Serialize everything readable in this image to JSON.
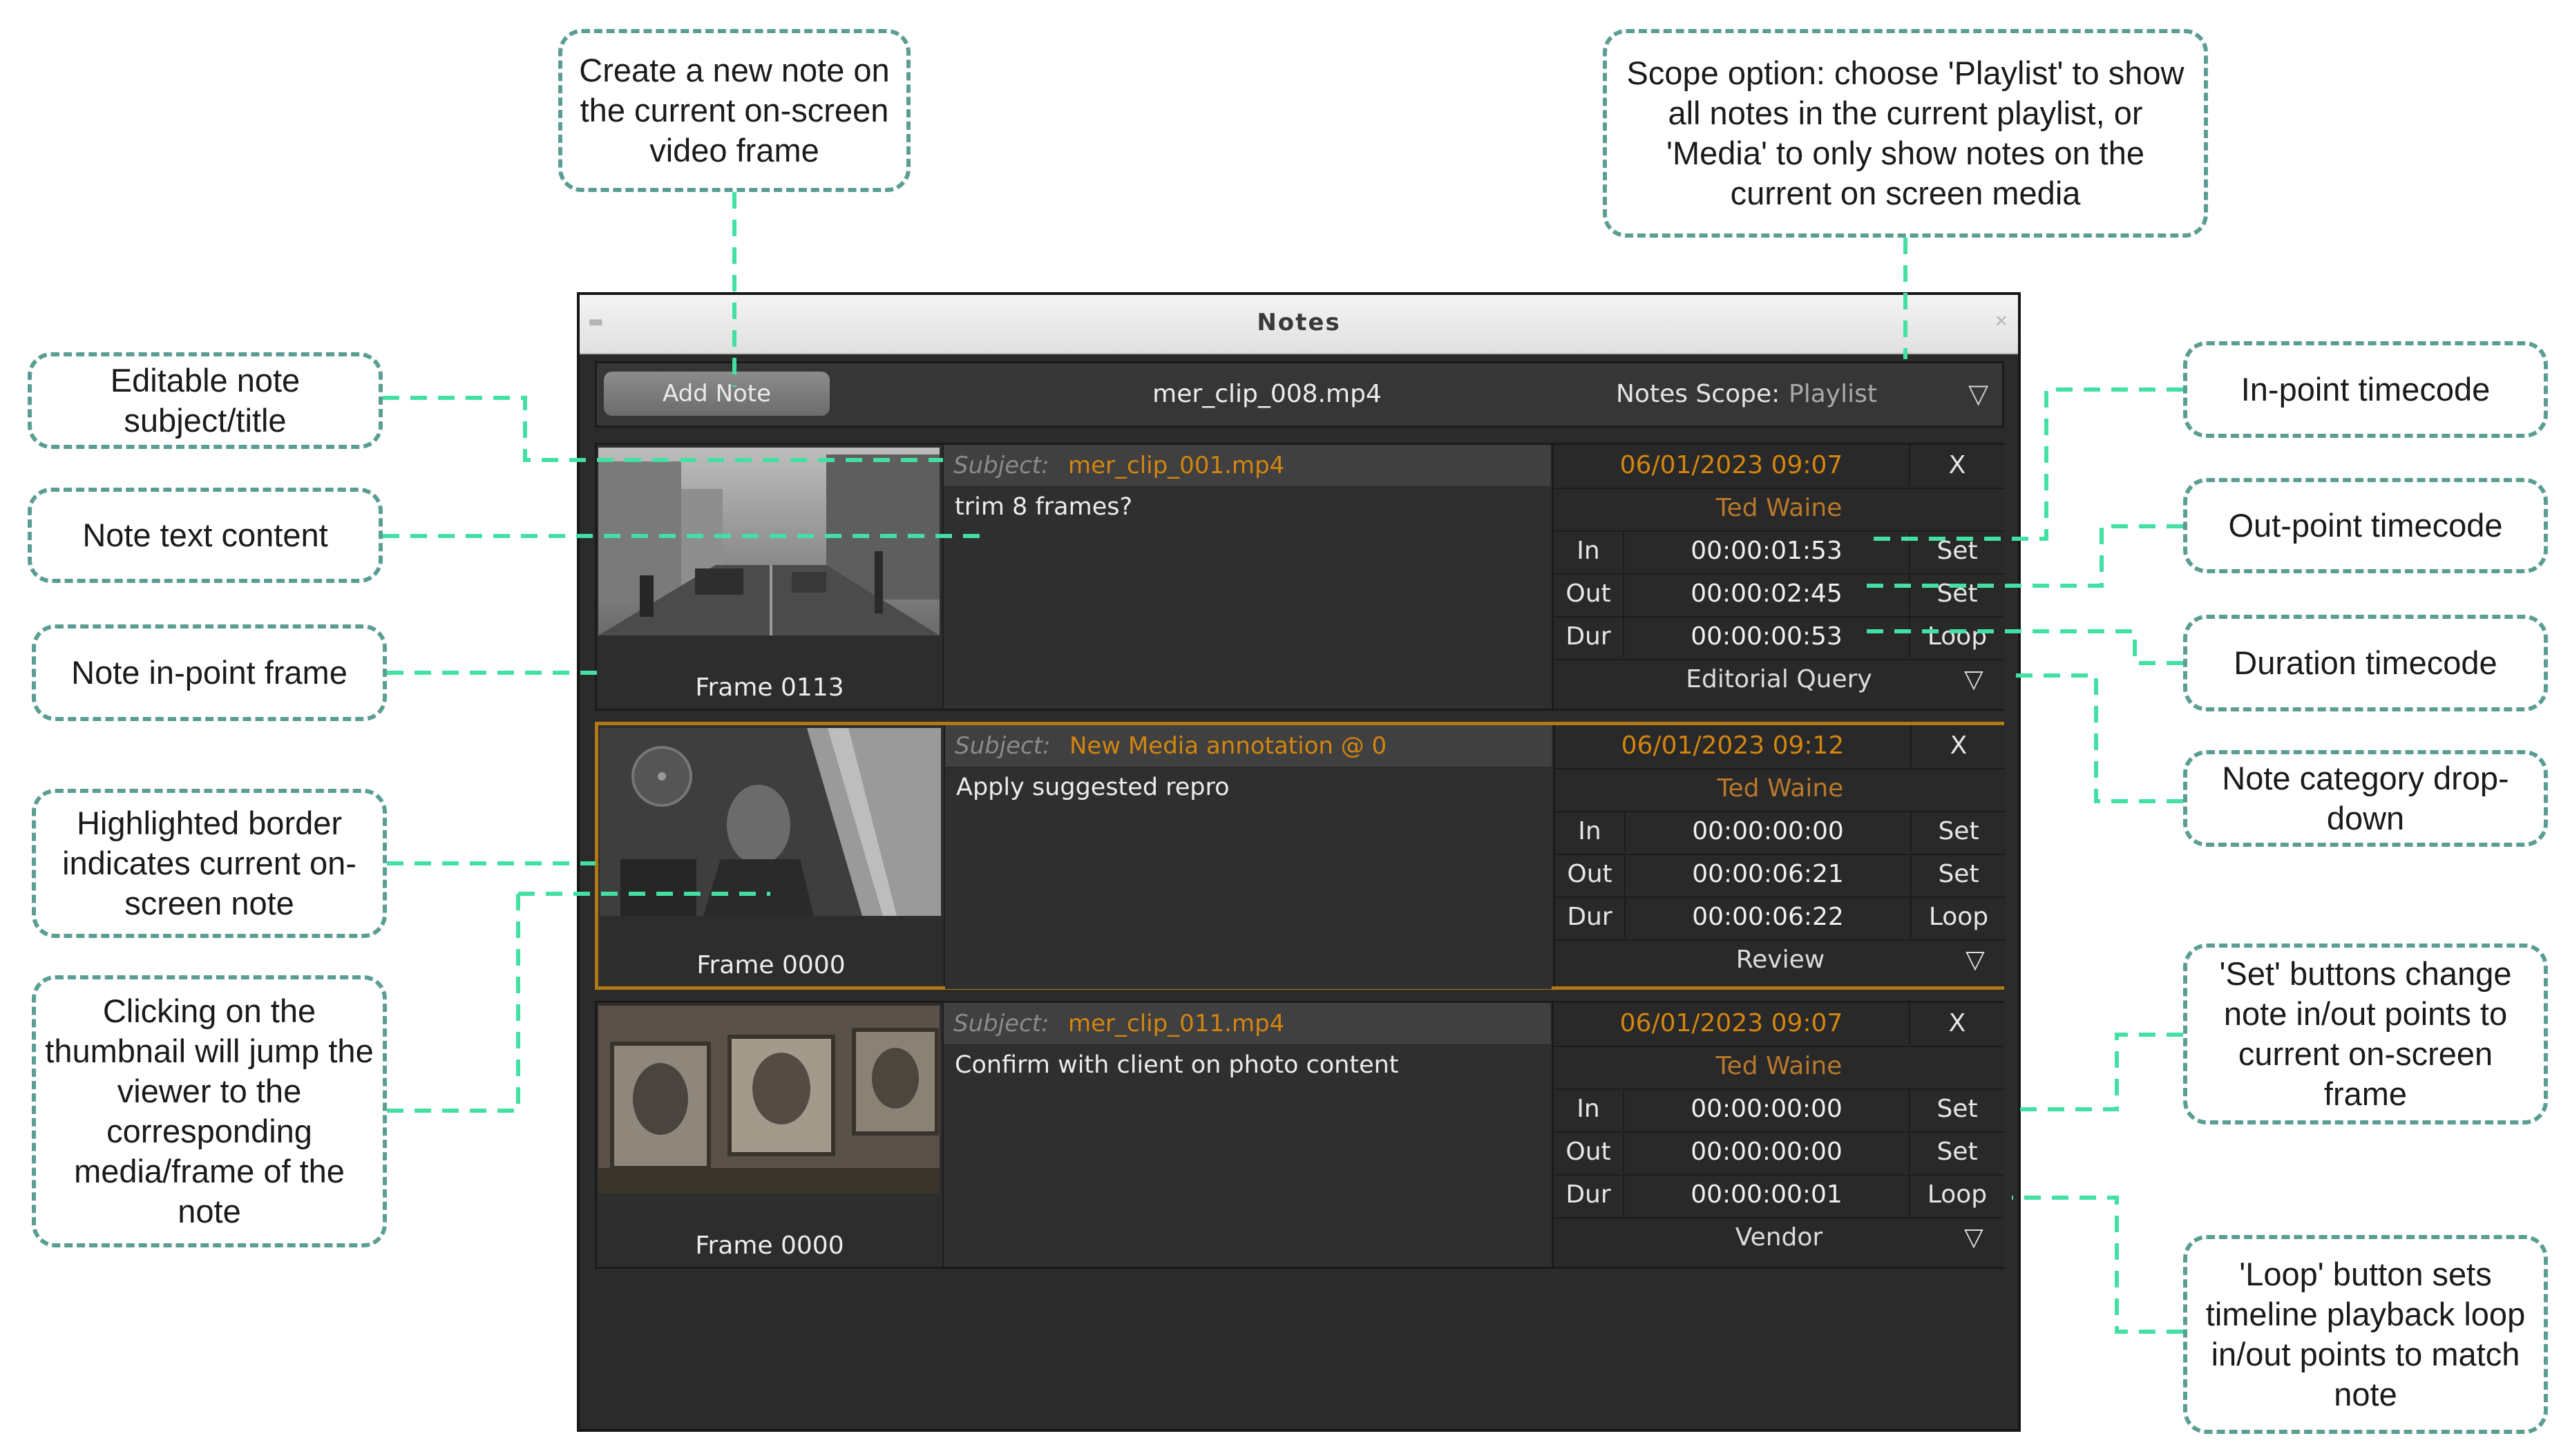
{
  "callouts": {
    "add_note": "Create a new note on\nthe current on-screen\nvideo frame",
    "scope": "Scope option: choose 'Playlist' to show\nall notes in the current playlist, or\n'Media' to only show notes on the\ncurrent on screen media",
    "subject": "Editable note\nsubject/title",
    "text_content": "Note text content",
    "in_frame": "Note in-point frame",
    "highlight": "Highlighted border\nindicates current on-\nscreen note",
    "thumbnail": "Clicking on the\nthumbnail will jump the\nviewer to the\ncorresponding\nmedia/frame of the\nnote",
    "in_tc": "In-point timecode",
    "out_tc": "Out-point timecode",
    "dur_tc": "Duration timecode",
    "category": "Note category drop-\ndown",
    "set_btn": "'Set' buttons change\nnote in/out points to\ncurrent on-screen frame",
    "loop_btn": "'Loop' button sets\ntimeline playback loop\nin/out points to match\nnote"
  },
  "window": {
    "title": "Notes",
    "add_note_label": "Add Note",
    "media_name": "mer_clip_008.mp4",
    "scope_label": "Notes Scope:",
    "scope_value": "Playlist",
    "dropdown_glyph": "▽",
    "close_glyph": "X"
  },
  "notes": [
    {
      "frame_label": "Frame 0113",
      "subject_prefix": "Subject:",
      "subject": "mer_clip_001.mp4",
      "text": "trim 8 frames?",
      "date": "06/01/2023 09:07",
      "author": "Ted Waine",
      "in_label": "In",
      "in_tc": "00:00:01:53",
      "out_label": "Out",
      "out_tc": "00:00:02:45",
      "dur_label": "Dur",
      "dur_tc": "00:00:00:53",
      "set_label": "Set",
      "loop_label": "Loop",
      "category": "Editorial Query",
      "current": false
    },
    {
      "frame_label": "Frame 0000",
      "subject_prefix": "Subject:",
      "subject": "New Media annotation @ 0",
      "text": "Apply suggested repro",
      "date": "06/01/2023 09:12",
      "author": "Ted Waine",
      "in_label": "In",
      "in_tc": "00:00:00:00",
      "out_label": "Out",
      "out_tc": "00:00:06:21",
      "dur_label": "Dur",
      "dur_tc": "00:00:06:22",
      "set_label": "Set",
      "loop_label": "Loop",
      "category": "Review",
      "current": true
    },
    {
      "frame_label": "Frame 0000",
      "subject_prefix": "Subject:",
      "subject": "mer_clip_011.mp4",
      "text": "Confirm with client on photo content",
      "date": "06/01/2023 09:07",
      "author": "Ted Waine",
      "in_label": "In",
      "in_tc": "00:00:00:00",
      "out_label": "Out",
      "out_tc": "00:00:00:00",
      "dur_label": "Dur",
      "dur_tc": "00:00:00:01",
      "set_label": "Set",
      "loop_label": "Loop",
      "category": "Vendor",
      "current": false
    }
  ]
}
